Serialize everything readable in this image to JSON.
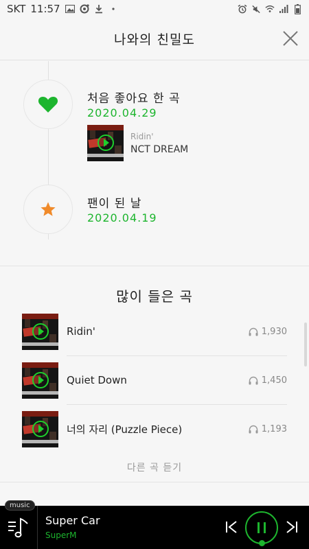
{
  "status_bar": {
    "carrier": "SKT",
    "time": "11:57",
    "icons_left": [
      "image-icon",
      "record-icon",
      "download-icon",
      "dot-icon"
    ],
    "icons_right": [
      "alarm-icon",
      "mute-icon",
      "wifi-icon",
      "signal-icon",
      "battery-icon"
    ]
  },
  "header": {
    "title": "나와의 친밀도"
  },
  "timeline": {
    "events": [
      {
        "icon": "heart-icon",
        "icon_color": "#1db52e",
        "title": "처음 좋아요 한 곡",
        "date": "2020.04.29",
        "song": {
          "title": "Ridin'",
          "artist": "NCT DREAM"
        }
      },
      {
        "icon": "star-icon",
        "icon_color": "#f08a2a",
        "title": "팬이 된 날",
        "date": "2020.04.19"
      }
    ]
  },
  "most_played": {
    "heading": "많이 들은 곡",
    "tracks": [
      {
        "name": "Ridin'",
        "plays": "1,930"
      },
      {
        "name": "Quiet Down",
        "plays": "1,450"
      },
      {
        "name": "너의 자리 (Puzzle Piece)",
        "plays": "1,193"
      }
    ],
    "more_label": "다른 곡 듣기"
  },
  "player": {
    "badge": "music",
    "song": "Super Car",
    "artist": "SuperM",
    "accent": "#1db52e"
  }
}
